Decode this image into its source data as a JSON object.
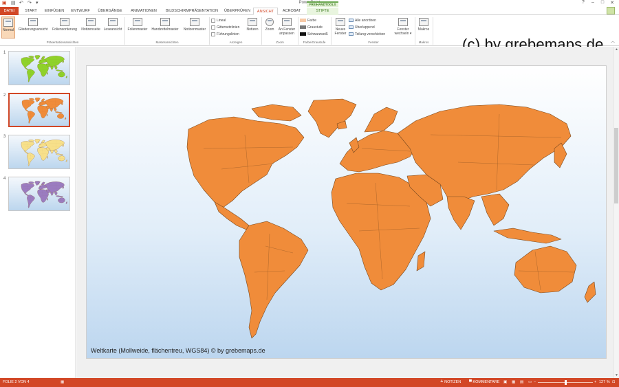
{
  "window": {
    "title": "PowerPoint",
    "controls": [
      "?",
      "–",
      "□",
      "✕"
    ]
  },
  "quick_access": {
    "undo": "↶",
    "redo": "↷",
    "more": "▾"
  },
  "tabs": [
    {
      "id": "datei",
      "label": "DATEI"
    },
    {
      "id": "start",
      "label": "START"
    },
    {
      "id": "einfuegen",
      "label": "EINFÜGEN"
    },
    {
      "id": "entwurf",
      "label": "ENTWURF"
    },
    {
      "id": "uebergaenge",
      "label": "ÜBERGÄNGE"
    },
    {
      "id": "animationen",
      "label": "ANIMATIONEN"
    },
    {
      "id": "bildschirm",
      "label": "BILDSCHIRMPRÄSENTATION"
    },
    {
      "id": "ueberpruefen",
      "label": "ÜBERPRÜFEN"
    },
    {
      "id": "ansicht",
      "label": "ANSICHT"
    },
    {
      "id": "acrobat",
      "label": "ACROBAT"
    },
    {
      "id": "stifte",
      "label": "STIFTE"
    }
  ],
  "context_group": "FREIHANDTOOLS",
  "ribbon": {
    "presentation_views": {
      "label": "Präsentationsansichten",
      "buttons": [
        "Normal",
        "Gliederungsansicht",
        "Foliensortierung",
        "Notizenseite",
        "Leseansicht"
      ]
    },
    "master_views": {
      "label": "Masteransichten",
      "buttons": [
        "Folienmaster",
        "Handzettelmaster",
        "Notizenmaster"
      ]
    },
    "show": {
      "label": "Anzeigen",
      "checks": [
        "Lineal",
        "Gitternetzlinien",
        "Führungslinien"
      ],
      "notes_button": "Notizen"
    },
    "zoom": {
      "label": "Zoom",
      "zoom_button": "Zoom",
      "fit_line1": "An Fenster",
      "fit_line2": "anpassen"
    },
    "color": {
      "label": "Farbe/Graustufe",
      "items": [
        "Farbe",
        "Graustufe",
        "Schwarzweiß"
      ]
    },
    "window": {
      "label": "Fenster",
      "new_line1": "Neues",
      "new_line2": "Fenster",
      "items": [
        "Alle anordnen",
        "Überlappend",
        "Teilung verschieben"
      ],
      "switch_line1": "Fenster",
      "switch_line2": "wechseln ▾"
    },
    "macros": {
      "label": "Makros",
      "button": "Makros"
    }
  },
  "watermark": "(c) by grebemaps.de",
  "thumbnails": [
    {
      "num": "1",
      "land_color": "#8fd22a",
      "selected": false
    },
    {
      "num": "2",
      "land_color": "#f08c3a",
      "selected": true
    },
    {
      "num": "3",
      "land_color": "#f7e08a",
      "selected": false
    },
    {
      "num": "4",
      "land_color": "#9b7cc0",
      "selected": false
    }
  ],
  "slide": {
    "caption": "Weltkarte (Mollweide, flächentreu, WGS84) © by grebemaps.de",
    "land_color": "#f08c3a"
  },
  "scrollbar": {
    "up": "▲",
    "down": "▼"
  },
  "status": {
    "slide_info": "FOLIE 2 VON 4",
    "notes": "≜ NOTIZEN",
    "comments": "▀ KOMMENTARE",
    "zoom": "127 %",
    "zoom_fraction": 0.5
  },
  "colors": {
    "accent": "#d24726"
  }
}
